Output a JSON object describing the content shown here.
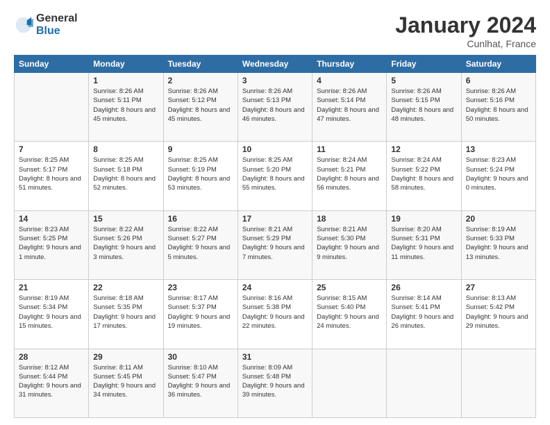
{
  "logo": {
    "general": "General",
    "blue": "Blue"
  },
  "title": "January 2024",
  "location": "Cunlhat, France",
  "days_header": [
    "Sunday",
    "Monday",
    "Tuesday",
    "Wednesday",
    "Thursday",
    "Friday",
    "Saturday"
  ],
  "weeks": [
    [
      {
        "day": "",
        "sunrise": "",
        "sunset": "",
        "daylight": ""
      },
      {
        "day": "1",
        "sunrise": "Sunrise: 8:26 AM",
        "sunset": "Sunset: 5:11 PM",
        "daylight": "Daylight: 8 hours and 45 minutes."
      },
      {
        "day": "2",
        "sunrise": "Sunrise: 8:26 AM",
        "sunset": "Sunset: 5:12 PM",
        "daylight": "Daylight: 8 hours and 45 minutes."
      },
      {
        "day": "3",
        "sunrise": "Sunrise: 8:26 AM",
        "sunset": "Sunset: 5:13 PM",
        "daylight": "Daylight: 8 hours and 46 minutes."
      },
      {
        "day": "4",
        "sunrise": "Sunrise: 8:26 AM",
        "sunset": "Sunset: 5:14 PM",
        "daylight": "Daylight: 8 hours and 47 minutes."
      },
      {
        "day": "5",
        "sunrise": "Sunrise: 8:26 AM",
        "sunset": "Sunset: 5:15 PM",
        "daylight": "Daylight: 8 hours and 48 minutes."
      },
      {
        "day": "6",
        "sunrise": "Sunrise: 8:26 AM",
        "sunset": "Sunset: 5:16 PM",
        "daylight": "Daylight: 8 hours and 50 minutes."
      }
    ],
    [
      {
        "day": "7",
        "sunrise": "Sunrise: 8:25 AM",
        "sunset": "Sunset: 5:17 PM",
        "daylight": "Daylight: 8 hours and 51 minutes."
      },
      {
        "day": "8",
        "sunrise": "Sunrise: 8:25 AM",
        "sunset": "Sunset: 5:18 PM",
        "daylight": "Daylight: 8 hours and 52 minutes."
      },
      {
        "day": "9",
        "sunrise": "Sunrise: 8:25 AM",
        "sunset": "Sunset: 5:19 PM",
        "daylight": "Daylight: 8 hours and 53 minutes."
      },
      {
        "day": "10",
        "sunrise": "Sunrise: 8:25 AM",
        "sunset": "Sunset: 5:20 PM",
        "daylight": "Daylight: 8 hours and 55 minutes."
      },
      {
        "day": "11",
        "sunrise": "Sunrise: 8:24 AM",
        "sunset": "Sunset: 5:21 PM",
        "daylight": "Daylight: 8 hours and 56 minutes."
      },
      {
        "day": "12",
        "sunrise": "Sunrise: 8:24 AM",
        "sunset": "Sunset: 5:22 PM",
        "daylight": "Daylight: 8 hours and 58 minutes."
      },
      {
        "day": "13",
        "sunrise": "Sunrise: 8:23 AM",
        "sunset": "Sunset: 5:24 PM",
        "daylight": "Daylight: 9 hours and 0 minutes."
      }
    ],
    [
      {
        "day": "14",
        "sunrise": "Sunrise: 8:23 AM",
        "sunset": "Sunset: 5:25 PM",
        "daylight": "Daylight: 9 hours and 1 minute."
      },
      {
        "day": "15",
        "sunrise": "Sunrise: 8:22 AM",
        "sunset": "Sunset: 5:26 PM",
        "daylight": "Daylight: 9 hours and 3 minutes."
      },
      {
        "day": "16",
        "sunrise": "Sunrise: 8:22 AM",
        "sunset": "Sunset: 5:27 PM",
        "daylight": "Daylight: 9 hours and 5 minutes."
      },
      {
        "day": "17",
        "sunrise": "Sunrise: 8:21 AM",
        "sunset": "Sunset: 5:29 PM",
        "daylight": "Daylight: 9 hours and 7 minutes."
      },
      {
        "day": "18",
        "sunrise": "Sunrise: 8:21 AM",
        "sunset": "Sunset: 5:30 PM",
        "daylight": "Daylight: 9 hours and 9 minutes."
      },
      {
        "day": "19",
        "sunrise": "Sunrise: 8:20 AM",
        "sunset": "Sunset: 5:31 PM",
        "daylight": "Daylight: 9 hours and 11 minutes."
      },
      {
        "day": "20",
        "sunrise": "Sunrise: 8:19 AM",
        "sunset": "Sunset: 5:33 PM",
        "daylight": "Daylight: 9 hours and 13 minutes."
      }
    ],
    [
      {
        "day": "21",
        "sunrise": "Sunrise: 8:19 AM",
        "sunset": "Sunset: 5:34 PM",
        "daylight": "Daylight: 9 hours and 15 minutes."
      },
      {
        "day": "22",
        "sunrise": "Sunrise: 8:18 AM",
        "sunset": "Sunset: 5:35 PM",
        "daylight": "Daylight: 9 hours and 17 minutes."
      },
      {
        "day": "23",
        "sunrise": "Sunrise: 8:17 AM",
        "sunset": "Sunset: 5:37 PM",
        "daylight": "Daylight: 9 hours and 19 minutes."
      },
      {
        "day": "24",
        "sunrise": "Sunrise: 8:16 AM",
        "sunset": "Sunset: 5:38 PM",
        "daylight": "Daylight: 9 hours and 22 minutes."
      },
      {
        "day": "25",
        "sunrise": "Sunrise: 8:15 AM",
        "sunset": "Sunset: 5:40 PM",
        "daylight": "Daylight: 9 hours and 24 minutes."
      },
      {
        "day": "26",
        "sunrise": "Sunrise: 8:14 AM",
        "sunset": "Sunset: 5:41 PM",
        "daylight": "Daylight: 9 hours and 26 minutes."
      },
      {
        "day": "27",
        "sunrise": "Sunrise: 8:13 AM",
        "sunset": "Sunset: 5:42 PM",
        "daylight": "Daylight: 9 hours and 29 minutes."
      }
    ],
    [
      {
        "day": "28",
        "sunrise": "Sunrise: 8:12 AM",
        "sunset": "Sunset: 5:44 PM",
        "daylight": "Daylight: 9 hours and 31 minutes."
      },
      {
        "day": "29",
        "sunrise": "Sunrise: 8:11 AM",
        "sunset": "Sunset: 5:45 PM",
        "daylight": "Daylight: 9 hours and 34 minutes."
      },
      {
        "day": "30",
        "sunrise": "Sunrise: 8:10 AM",
        "sunset": "Sunset: 5:47 PM",
        "daylight": "Daylight: 9 hours and 36 minutes."
      },
      {
        "day": "31",
        "sunrise": "Sunrise: 8:09 AM",
        "sunset": "Sunset: 5:48 PM",
        "daylight": "Daylight: 9 hours and 39 minutes."
      },
      {
        "day": "",
        "sunrise": "",
        "sunset": "",
        "daylight": ""
      },
      {
        "day": "",
        "sunrise": "",
        "sunset": "",
        "daylight": ""
      },
      {
        "day": "",
        "sunrise": "",
        "sunset": "",
        "daylight": ""
      }
    ]
  ]
}
